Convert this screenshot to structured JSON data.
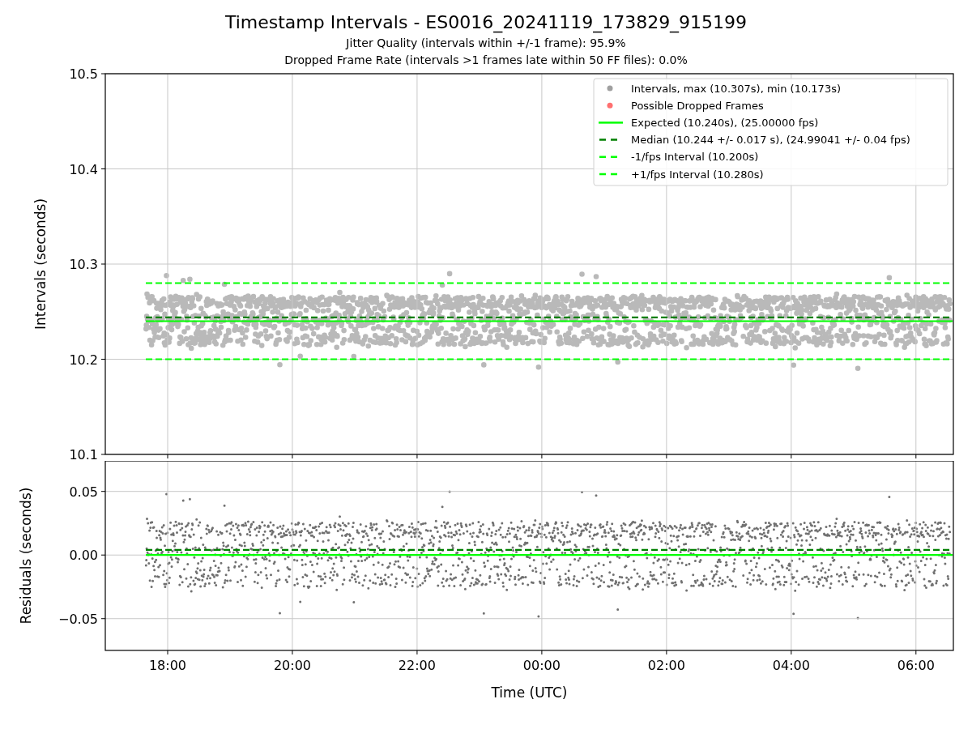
{
  "title": "Timestamp Intervals - ES0016_20241119_173829_915199",
  "subtitles": [
    "Jitter Quality (intervals within +/-1 frame): 95.9%",
    "Dropped Frame Rate (intervals >1 frames late within 50 FF files): 0.0%"
  ],
  "top_panel": {
    "legend_markers": [
      {
        "color": "#a0a0a0",
        "label": "Intervals, max (10.307s), min (10.173s)"
      },
      {
        "color": "#ff7070",
        "label": "Possible Dropped Frames"
      }
    ],
    "chart_data": {
      "type": "line",
      "ylabel": "Intervals (seconds)",
      "x": [
        "2024-11-19T17:39",
        "2024-11-20T06:36"
      ],
      "xlim": [
        "2024-11-19T17:00",
        "2024-11-20T06:36"
      ],
      "ylim": [
        10.1,
        10.5
      ],
      "grid": true,
      "legend": true,
      "yticks": [
        {
          "value": 10.1,
          "label": "10.1"
        },
        {
          "value": 10.2,
          "label": "10.2"
        },
        {
          "value": 10.3,
          "label": "10.3"
        },
        {
          "value": 10.4,
          "label": "10.4"
        },
        {
          "value": 10.5,
          "label": "10.5"
        }
      ],
      "series": [
        {
          "name": "Expected (10.240s), (25.00000 fps)",
          "color": "#00ff00",
          "line_style": "solid",
          "values": [
            10.24,
            10.24
          ]
        },
        {
          "name": "Median (10.244 +/- 0.017 s), (24.99041 +/- 0.04 fps)",
          "color": "#008000",
          "line_style": "dashed",
          "values": [
            10.244,
            10.244
          ]
        },
        {
          "name": "-1/fps Interval (10.200s)",
          "color": "#00ff00",
          "line_style": "dashed",
          "values": [
            10.2,
            10.2
          ]
        },
        {
          "name": "+1/fps Interval (10.280s)",
          "color": "#00ff00",
          "line_style": "dashed",
          "values": [
            10.28,
            10.28
          ]
        }
      ]
    }
  },
  "bottom_panel": {
    "chart_data": {
      "type": "line",
      "xlabel": "Time (UTC)",
      "ylabel": "Residuals (seconds)",
      "x": [
        "2024-11-19T17:39",
        "2024-11-20T06:36"
      ],
      "xlim": [
        "2024-11-19T17:00",
        "2024-11-20T06:36"
      ],
      "ylim": [
        -0.075,
        0.074
      ],
      "grid": true,
      "xticks": [
        {
          "value": "2024-11-19T18:00",
          "label": "18:00"
        },
        {
          "value": "2024-11-19T20:00",
          "label": "20:00"
        },
        {
          "value": "2024-11-19T22:00",
          "label": "22:00"
        },
        {
          "value": "2024-11-20T00:00",
          "label": "00:00"
        },
        {
          "value": "2024-11-20T02:00",
          "label": "02:00"
        },
        {
          "value": "2024-11-20T04:00",
          "label": "04:00"
        },
        {
          "value": "2024-11-20T06:00",
          "label": "06:00"
        }
      ],
      "yticks": [
        {
          "value": -0.05,
          "label": "−0.05"
        },
        {
          "value": 0,
          "label": "0.00"
        },
        {
          "value": 0.05,
          "label": "0.05"
        }
      ],
      "series": [
        {
          "color": "#00ff00",
          "line_style": "solid",
          "values": [
            0,
            0
          ]
        },
        {
          "color": "#008000",
          "line_style": "dashed",
          "values": [
            0.004,
            0.004
          ]
        }
      ]
    }
  }
}
